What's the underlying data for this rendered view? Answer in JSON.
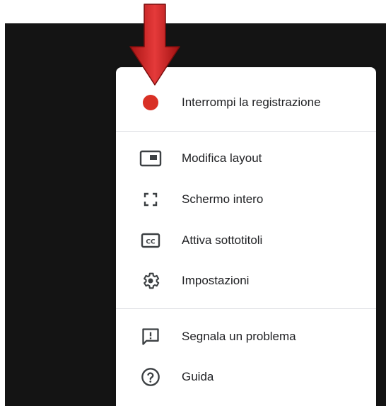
{
  "menu": {
    "record_item": {
      "label": "Interrompi la registrazione",
      "icon": "record-dot-icon",
      "color": "#d93025"
    },
    "group1": [
      {
        "key": "layout",
        "label": "Modifica layout",
        "icon": "layout-icon"
      },
      {
        "key": "fullscreen",
        "label": "Schermo intero",
        "icon": "fullscreen-icon"
      },
      {
        "key": "captions",
        "label": "Attiva sottotitoli",
        "icon": "closed-captions-icon"
      },
      {
        "key": "settings",
        "label": "Impostazioni",
        "icon": "gear-icon"
      }
    ],
    "group2": [
      {
        "key": "report",
        "label": "Segnala un problema",
        "icon": "feedback-icon"
      },
      {
        "key": "help",
        "label": "Guida",
        "icon": "help-icon"
      }
    ]
  },
  "colors": {
    "background": "#141414",
    "menu_bg": "#ffffff",
    "text": "#202124",
    "icon": "#3c4043",
    "arrow": "#cc1f1f"
  }
}
